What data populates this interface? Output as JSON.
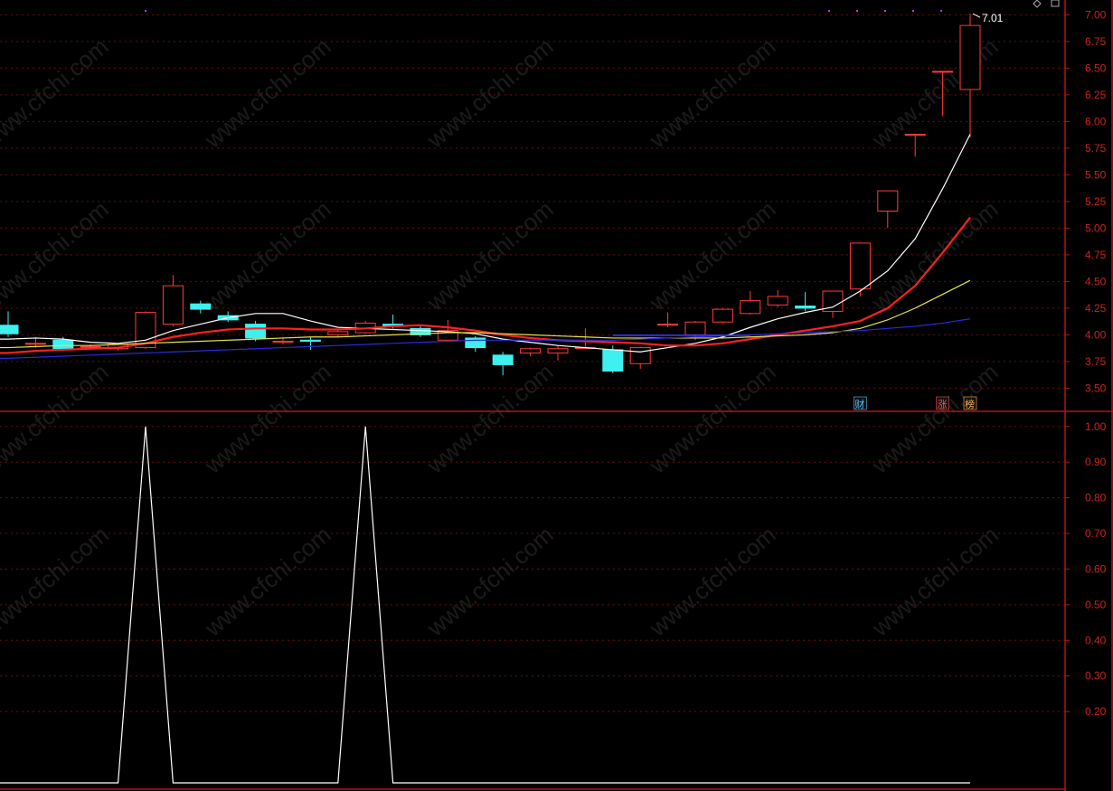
{
  "watermark": "www.cfchi.com",
  "colors": {
    "up": "#ff3b3b",
    "down": "#3ef0f0",
    "axis": "#b01515",
    "grid": "#6a0f0f",
    "ma_white": "#ffffff",
    "ma_red": "#ff2020",
    "ma_yellow": "#e6e64a",
    "ma_blue": "#2a2ae0",
    "indicator": "#ffffff"
  },
  "chart_data": [
    {
      "type": "candlestick",
      "name": "price",
      "ylim": [
        3.3,
        7.02
      ],
      "yticks": [
        "7.00",
        "6.75",
        "6.50",
        "6.25",
        "6.00",
        "5.75",
        "5.50",
        "5.25",
        "5.00",
        "4.75",
        "4.50",
        "4.25",
        "4.00",
        "3.75",
        "3.50"
      ],
      "grid": true,
      "high_label": "7.01",
      "candles": [
        {
          "o": 4.09,
          "h": 4.22,
          "l": 3.98,
          "c": 4.01
        },
        {
          "o": 3.92,
          "h": 3.98,
          "l": 3.88,
          "c": 3.92
        },
        {
          "o": 3.95,
          "h": 3.98,
          "l": 3.86,
          "c": 3.87
        },
        {
          "o": 3.89,
          "h": 3.91,
          "l": 3.86,
          "c": 3.89
        },
        {
          "o": 3.87,
          "h": 3.92,
          "l": 3.85,
          "c": 3.91
        },
        {
          "o": 3.88,
          "h": 4.22,
          "l": 3.87,
          "c": 4.21
        },
        {
          "o": 4.1,
          "h": 4.56,
          "l": 4.08,
          "c": 4.46
        },
        {
          "o": 4.29,
          "h": 4.32,
          "l": 4.2,
          "c": 4.24
        },
        {
          "o": 4.18,
          "h": 4.22,
          "l": 4.12,
          "c": 4.14
        },
        {
          "o": 4.1,
          "h": 4.13,
          "l": 3.94,
          "c": 3.97
        },
        {
          "o": 3.94,
          "h": 3.98,
          "l": 3.91,
          "c": 3.94
        },
        {
          "o": 3.95,
          "h": 3.98,
          "l": 3.86,
          "c": 3.94
        },
        {
          "o": 4.0,
          "h": 4.05,
          "l": 3.98,
          "c": 4.03
        },
        {
          "o": 4.02,
          "h": 4.13,
          "l": 4.01,
          "c": 4.11
        },
        {
          "o": 4.1,
          "h": 4.19,
          "l": 4.06,
          "c": 4.08
        },
        {
          "o": 4.06,
          "h": 4.08,
          "l": 3.98,
          "c": 4.0
        },
        {
          "o": 3.95,
          "h": 4.14,
          "l": 3.94,
          "c": 4.04
        },
        {
          "o": 3.97,
          "h": 3.99,
          "l": 3.84,
          "c": 3.88
        },
        {
          "o": 3.81,
          "h": 3.84,
          "l": 3.62,
          "c": 3.72
        },
        {
          "o": 3.83,
          "h": 3.88,
          "l": 3.8,
          "c": 3.87
        },
        {
          "o": 3.83,
          "h": 3.9,
          "l": 3.76,
          "c": 3.87
        },
        {
          "o": 3.88,
          "h": 4.06,
          "l": 3.87,
          "c": 3.88
        },
        {
          "o": 3.86,
          "h": 3.9,
          "l": 3.64,
          "c": 3.66
        },
        {
          "o": 3.73,
          "h": 3.88,
          "l": 3.68,
          "c": 3.88
        },
        {
          "o": 4.1,
          "h": 4.21,
          "l": 4.07,
          "c": 4.1
        },
        {
          "o": 4.0,
          "h": 4.13,
          "l": 3.95,
          "c": 4.12
        },
        {
          "o": 4.12,
          "h": 4.25,
          "l": 4.11,
          "c": 4.24
        },
        {
          "o": 4.2,
          "h": 4.41,
          "l": 4.19,
          "c": 4.32
        },
        {
          "o": 4.28,
          "h": 4.42,
          "l": 4.26,
          "c": 4.36
        },
        {
          "o": 4.27,
          "h": 4.4,
          "l": 4.22,
          "c": 4.25
        },
        {
          "o": 4.22,
          "h": 4.41,
          "l": 4.16,
          "c": 4.41
        },
        {
          "o": 4.43,
          "h": 4.86,
          "l": 4.36,
          "c": 4.86
        },
        {
          "o": 5.16,
          "h": 5.35,
          "l": 5.0,
          "c": 5.35
        },
        {
          "o": 5.88,
          "h": 5.88,
          "l": 5.67,
          "c": 5.88
        },
        {
          "o": 6.47,
          "h": 6.47,
          "l": 6.05,
          "c": 6.47
        },
        {
          "o": 6.3,
          "h": 7.01,
          "l": 5.85,
          "c": 6.9
        }
      ],
      "ma": [
        {
          "color": "#ffffff",
          "values": [
            3.96,
            3.97,
            3.96,
            3.93,
            3.92,
            3.95,
            4.04,
            4.1,
            4.16,
            4.2,
            4.2,
            4.13,
            4.07,
            4.06,
            4.05,
            4.04,
            4.03,
            4.01,
            3.96,
            3.93,
            3.9,
            3.88,
            3.86,
            3.84,
            3.88,
            3.92,
            3.98,
            4.07,
            4.15,
            4.21,
            4.26,
            4.41,
            4.6,
            4.9,
            5.37,
            5.88
          ]
        },
        {
          "color": "#ff2020",
          "values": [
            3.83,
            3.85,
            3.86,
            3.87,
            3.88,
            3.92,
            3.98,
            4.02,
            4.05,
            4.06,
            4.06,
            4.05,
            4.05,
            4.06,
            4.08,
            4.09,
            4.07,
            4.04,
            4.0,
            3.97,
            3.95,
            3.94,
            3.93,
            3.92,
            3.9,
            3.9,
            3.92,
            3.96,
            4.0,
            4.04,
            4.08,
            4.13,
            4.25,
            4.46,
            4.77,
            5.1
          ]
        },
        {
          "color": "#e6e64a",
          "values": [
            3.88,
            3.89,
            3.9,
            3.9,
            3.91,
            3.92,
            3.93,
            3.94,
            3.95,
            3.96,
            3.97,
            3.98,
            3.98,
            3.99,
            4.0,
            4.01,
            4.02,
            4.02,
            4.01,
            4.0,
            3.99,
            3.98,
            3.97,
            3.97,
            3.97,
            3.97,
            3.97,
            3.98,
            3.99,
            4.0,
            4.02,
            4.06,
            4.14,
            4.25,
            4.38,
            4.51
          ]
        },
        {
          "color": "#2a2ae0",
          "values": [
            3.78,
            3.79,
            3.8,
            3.81,
            3.82,
            3.83,
            3.84,
            3.85,
            3.86,
            3.87,
            3.88,
            3.89,
            3.9,
            3.91,
            3.92,
            3.93,
            3.94,
            3.95,
            3.95,
            3.95,
            3.95,
            3.95,
            3.95,
            3.96,
            3.97,
            3.98,
            3.99,
            4.0,
            4.01,
            4.02,
            4.03,
            4.04,
            4.06,
            4.08,
            4.11,
            4.15
          ]
        }
      ],
      "flag_line": {
        "color": "#3a3aff",
        "from": 22,
        "to": 27,
        "value": 3.996
      },
      "markers": [
        {
          "text": "财",
          "index": 31,
          "color": "#4fc3ff"
        },
        {
          "text": "涨",
          "index": 34,
          "color": "#ff4d4d"
        },
        {
          "text": "榜",
          "index": 35,
          "color": "#ffb347"
        }
      ]
    },
    {
      "type": "line",
      "name": "indicator",
      "ylim": [
        0,
        1.04
      ],
      "yticks": [
        "1.00",
        "0.90",
        "0.80",
        "0.70",
        "0.60",
        "0.50",
        "0.40",
        "0.30",
        "0.20"
      ],
      "grid": true,
      "series": [
        {
          "values": [
            0,
            0,
            0,
            0,
            0,
            1,
            0,
            0,
            0,
            0,
            0,
            0,
            0,
            1,
            0,
            0,
            0,
            0,
            0,
            0,
            0,
            0,
            0,
            0,
            0,
            0,
            0,
            0,
            0,
            0,
            0,
            0,
            0,
            0,
            0,
            0
          ]
        }
      ]
    }
  ]
}
